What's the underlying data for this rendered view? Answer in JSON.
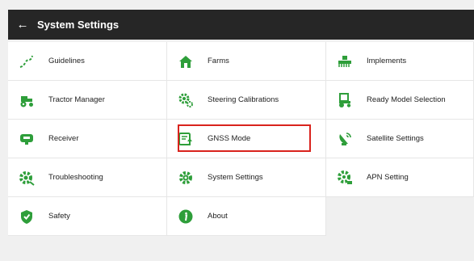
{
  "header": {
    "title": "System Settings",
    "back_icon": "arrow-left-icon"
  },
  "accent_color": "#2e9e3a",
  "highlight_color": "#d9231d",
  "menu": {
    "guidelines": "Guidelines",
    "farms": "Farms",
    "implements": "Implements",
    "tractor_manager": "Tractor Manager",
    "steering_calibrations": "Steering Calibrations",
    "ready_model_selection": "Ready Model Selection",
    "receiver": "Receiver",
    "gnss_mode": "GNSS Mode",
    "satellite_settings": "Satellite Settings",
    "troubleshooting": "Troubleshooting",
    "system_settings": "System Settings",
    "apn_setting": "APN Setting",
    "safety": "Safety",
    "about": "About"
  },
  "selected_item": "gnss_mode"
}
